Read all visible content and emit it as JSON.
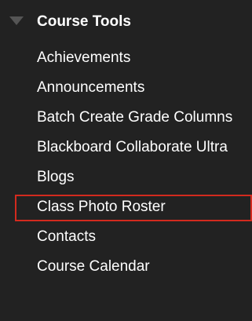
{
  "course_tools": {
    "header_label": "Course Tools",
    "items": [
      {
        "label": "Achievements"
      },
      {
        "label": "Announcements"
      },
      {
        "label": "Batch Create Grade Columns"
      },
      {
        "label": "Blackboard Collaborate Ultra"
      },
      {
        "label": "Blogs"
      },
      {
        "label": "Class Photo Roster",
        "highlighted": true
      },
      {
        "label": "Contacts"
      },
      {
        "label": "Course Calendar"
      }
    ]
  },
  "colors": {
    "panel_background": "#222222",
    "text": "#ffffff",
    "caret": "#555555",
    "highlight_border": "#d32a1e"
  },
  "icons": {
    "header_toggle": "caret-down-icon"
  }
}
